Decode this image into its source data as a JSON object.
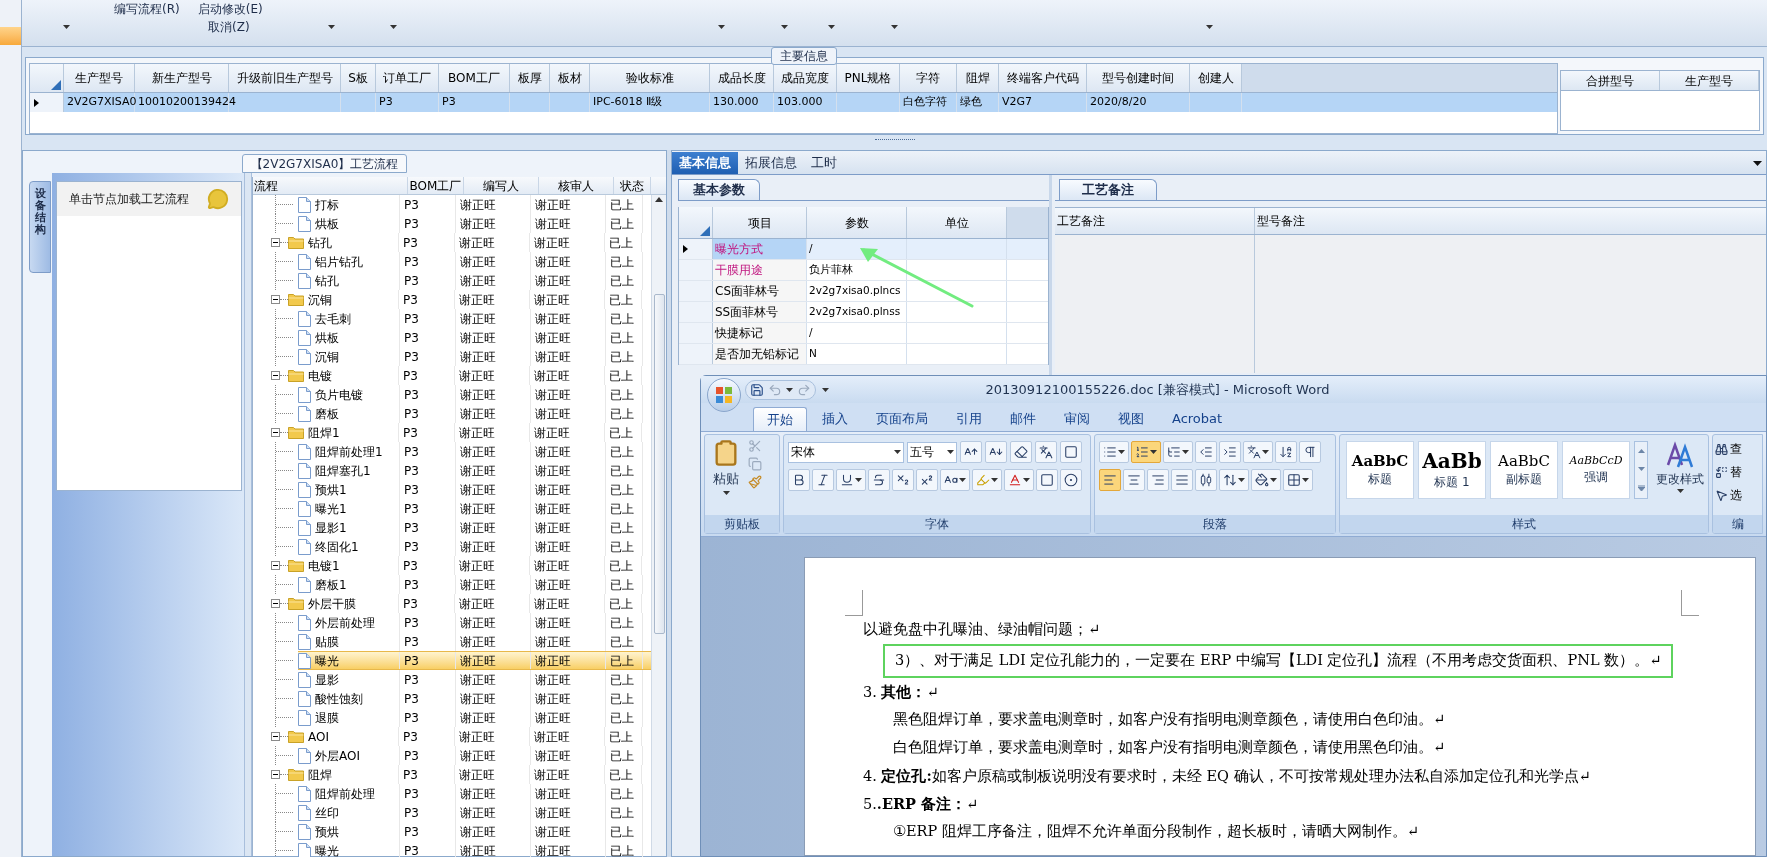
{
  "toolbar": {
    "menu_items": [
      "编写流程(R)",
      "启动修改(E)",
      "取消(Z)"
    ]
  },
  "main_info": {
    "title": "主要信息",
    "columns": [
      "生产型号",
      "新生产型号",
      "升级前旧生产型号",
      "S板",
      "订单工厂",
      "BOM工厂",
      "板厚",
      "板材",
      "验收标准",
      "成品长度",
      "成品宽度",
      "PNL规格",
      "字符",
      "阻焊",
      "终端客户代码",
      "型号创建时间",
      "创建人"
    ],
    "rows": [
      {
        "selected": true,
        "cells": [
          "2V2G7XISA0",
          "10010200139424",
          null,
          null,
          "P3",
          "P3",
          null,
          null,
          "IPC-6018 Ⅱ级",
          "130.000",
          "103.000",
          null,
          "白色字符",
          "绿色",
          "V2G7",
          "2020/8/20",
          null
        ]
      }
    ],
    "side_columns": [
      "合拼型号",
      "生产型号"
    ]
  },
  "process_panel": {
    "title": "【2V2G7XISA0】工艺流程",
    "side_tab": "设备结构",
    "hint": "单击节点加载工艺流程",
    "columns": [
      "流程",
      "BOM工厂",
      "编写人",
      "核审人",
      "状态"
    ],
    "tree": [
      {
        "children": [
          {
            "label": "打标",
            "selected": false,
            "cells": [
              "P3",
              "谢正旺",
              "谢正旺",
              "已上"
            ]
          },
          {
            "label": "烘板",
            "selected": false,
            "cells": [
              "P3",
              "谢正旺",
              "谢正旺",
              "已上"
            ]
          }
        ]
      },
      {
        "label": "钻孔",
        "expanded": true,
        "selected": false,
        "cells": [
          "P3",
          "谢正旺",
          "谢正旺",
          "已上"
        ],
        "children": [
          {
            "label": "铝片钻孔",
            "selected": false,
            "cells": [
              "P3",
              "谢正旺",
              "谢正旺",
              "已上"
            ]
          },
          {
            "label": "钻孔",
            "selected": false,
            "cells": [
              "P3",
              "谢正旺",
              "谢正旺",
              "已上"
            ]
          }
        ]
      },
      {
        "label": "沉铜",
        "expanded": true,
        "selected": false,
        "cells": [
          "P3",
          "谢正旺",
          "谢正旺",
          "已上"
        ],
        "children": [
          {
            "label": "去毛刺",
            "selected": false,
            "cells": [
              "P3",
              "谢正旺",
              "谢正旺",
              "已上"
            ]
          },
          {
            "label": "烘板",
            "selected": false,
            "cells": [
              "P3",
              "谢正旺",
              "谢正旺",
              "已上"
            ]
          },
          {
            "label": "沉铜",
            "selected": false,
            "cells": [
              "P3",
              "谢正旺",
              "谢正旺",
              "已上"
            ]
          }
        ]
      },
      {
        "label": "电镀",
        "expanded": true,
        "selected": false,
        "cells": [
          "P3",
          "谢正旺",
          "谢正旺",
          "已上"
        ],
        "children": [
          {
            "label": "负片电镀",
            "selected": false,
            "cells": [
              "P3",
              "谢正旺",
              "谢正旺",
              "已上"
            ]
          },
          {
            "label": "磨板",
            "selected": false,
            "cells": [
              "P3",
              "谢正旺",
              "谢正旺",
              "已上"
            ]
          }
        ]
      },
      {
        "label": "阻焊1",
        "expanded": true,
        "selected": false,
        "cells": [
          "P3",
          "谢正旺",
          "谢正旺",
          "已上"
        ],
        "children": [
          {
            "label": "阻焊前处理1",
            "selected": false,
            "cells": [
              "P3",
              "谢正旺",
              "谢正旺",
              "已上"
            ]
          },
          {
            "label": "阻焊塞孔1",
            "selected": false,
            "cells": [
              "P3",
              "谢正旺",
              "谢正旺",
              "已上"
            ]
          },
          {
            "label": "预烘1",
            "selected": false,
            "cells": [
              "P3",
              "谢正旺",
              "谢正旺",
              "已上"
            ]
          },
          {
            "label": "曝光1",
            "selected": false,
            "cells": [
              "P3",
              "谢正旺",
              "谢正旺",
              "已上"
            ]
          },
          {
            "label": "显影1",
            "selected": false,
            "cells": [
              "P3",
              "谢正旺",
              "谢正旺",
              "已上"
            ]
          },
          {
            "label": "终固化1",
            "selected": false,
            "cells": [
              "P3",
              "谢正旺",
              "谢正旺",
              "已上"
            ]
          }
        ]
      },
      {
        "label": "电镀1",
        "expanded": true,
        "selected": false,
        "cells": [
          "P3",
          "谢正旺",
          "谢正旺",
          "已上"
        ],
        "children": [
          {
            "label": "磨板1",
            "selected": false,
            "cells": [
              "P3",
              "谢正旺",
              "谢正旺",
              "已上"
            ]
          }
        ]
      },
      {
        "label": "外层干膜",
        "expanded": true,
        "selected": false,
        "cells": [
          "P3",
          "谢正旺",
          "谢正旺",
          "已上"
        ],
        "children": [
          {
            "label": "外层前处理",
            "selected": false,
            "cells": [
              "P3",
              "谢正旺",
              "谢正旺",
              "已上"
            ]
          },
          {
            "label": "贴膜",
            "selected": false,
            "cells": [
              "P3",
              "谢正旺",
              "谢正旺",
              "已上"
            ]
          },
          {
            "label": "曝光",
            "selected": true,
            "cells": [
              "P3",
              "谢正旺",
              "谢正旺",
              "已上"
            ]
          },
          {
            "label": "显影",
            "selected": false,
            "cells": [
              "P3",
              "谢正旺",
              "谢正旺",
              "已上"
            ]
          },
          {
            "label": "酸性蚀刻",
            "selected": false,
            "cells": [
              "P3",
              "谢正旺",
              "谢正旺",
              "已上"
            ]
          },
          {
            "label": "退膜",
            "selected": false,
            "cells": [
              "P3",
              "谢正旺",
              "谢正旺",
              "已上"
            ]
          }
        ]
      },
      {
        "label": "AOI",
        "expanded": true,
        "selected": false,
        "cells": [
          "P3",
          "谢正旺",
          "谢正旺",
          "已上"
        ],
        "children": [
          {
            "label": "外层AOI",
            "selected": false,
            "cells": [
              "P3",
              "谢正旺",
              "谢正旺",
              "已上"
            ]
          }
        ]
      },
      {
        "label": "阻焊",
        "expanded": true,
        "selected": false,
        "cells": [
          "P3",
          "谢正旺",
          "谢正旺",
          "已上"
        ],
        "children": [
          {
            "label": "阻焊前处理",
            "selected": false,
            "cells": [
              "P3",
              "谢正旺",
              "谢正旺",
              "已上"
            ]
          },
          {
            "label": "丝印",
            "selected": false,
            "cells": [
              "P3",
              "谢正旺",
              "谢正旺",
              "已上"
            ]
          },
          {
            "label": "预烘",
            "selected": false,
            "cells": [
              "P3",
              "谢正旺",
              "谢正旺",
              "已上"
            ]
          },
          {
            "label": "曝光",
            "selected": false,
            "cells": [
              "P3",
              "谢正旺",
              "谢正旺",
              "已上"
            ]
          }
        ]
      }
    ]
  },
  "detail_panel": {
    "tabs": [
      {
        "label": "基本信息",
        "selected": true
      },
      {
        "label": "拓展信息",
        "selected": false
      },
      {
        "label": "工时",
        "selected": false
      }
    ],
    "sub_tab": "基本参数",
    "param_columns": [
      "项目",
      "参数",
      "单位"
    ],
    "params": [
      {
        "item": "曝光方式",
        "value": "/",
        "highlight": true,
        "selected": true
      },
      {
        "item": "干膜用途",
        "value": "负片菲林",
        "highlight": true,
        "selected": false
      },
      {
        "item": "CS面菲林号",
        "value": "2v2g7xisa0.plncs",
        "highlight": false,
        "selected": false
      },
      {
        "item": "SS面菲林号",
        "value": "2v2g7xisa0.plnss",
        "highlight": false,
        "selected": false
      },
      {
        "item": "快捷标记",
        "value": "/",
        "highlight": false,
        "selected": false
      },
      {
        "item": "是否加无铅标记",
        "value": "N",
        "highlight": false,
        "selected": false
      }
    ],
    "remarks_tab": "工艺备注",
    "remark_columns": [
      "工艺备注",
      "型号备注"
    ]
  },
  "word_window": {
    "title": "20130912100155226.doc [兼容模式] - Microsoft Word",
    "tabs": [
      {
        "label": "开始",
        "selected": true
      },
      {
        "label": "插入",
        "selected": false
      },
      {
        "label": "页面布局",
        "selected": false
      },
      {
        "label": "引用",
        "selected": false
      },
      {
        "label": "邮件",
        "selected": false
      },
      {
        "label": "审阅",
        "selected": false
      },
      {
        "label": "视图",
        "selected": false
      },
      {
        "label": "Acrobat",
        "selected": false
      }
    ],
    "paste_label": "粘贴",
    "font_name": "宋体",
    "font_size": "五号",
    "paragraph_tools": [
      {
        "kind": "bullets",
        "on": false
      },
      {
        "kind": "numbering",
        "on": true
      },
      {
        "kind": "multilevel",
        "on": false
      },
      {
        "kind": "outdent",
        "on": false
      },
      {
        "kind": "indent",
        "on": false
      },
      {
        "kind": "asian",
        "on": false
      },
      {
        "kind": "sort",
        "on": false
      },
      {
        "kind": "marks",
        "on": false
      }
    ],
    "alignments": [
      {
        "kind": "left",
        "on": true
      },
      {
        "kind": "center",
        "on": false
      },
      {
        "kind": "right",
        "on": false
      },
      {
        "kind": "justify",
        "on": false
      },
      {
        "kind": "distributed",
        "on": false
      }
    ],
    "styles": [
      {
        "kind": "title",
        "preview": "AaBbC",
        "name": "标题"
      },
      {
        "kind": "heading",
        "preview": "AaBb",
        "name": "标题 1"
      },
      {
        "kind": "subtitle",
        "preview": "AaBbC",
        "name": "副标题"
      },
      {
        "kind": "emphasis",
        "preview": "AaBbCcD",
        "name": "强调"
      }
    ],
    "change_styles": "更改样式",
    "edit_items": [
      "查",
      "替",
      "选"
    ],
    "groups": [
      "剪贴板",
      "字体",
      "段落",
      "样式",
      "编"
    ],
    "paragraphs": [
      {
        "text": "以避免盘中孔曝油、绿油帽问题；↵",
        "kind": "plain",
        "framed": false
      },
      {
        "text": "3）、对于满足 LDI 定位孔能力的，一定要在 ERP 中编写【LDI 定位孔】流程（不用考虑交货面积、PNL 数）。↵",
        "kind": "indented",
        "framed": true
      },
      {
        "text": "3. **其他：**↵",
        "kind": "plain",
        "framed": false
      },
      {
        "text": "黑色阻焊订单，要求盖电测章时，如客户没有指明电测章颜色，请使用白色印油。↵",
        "kind": "indented",
        "framed": false
      },
      {
        "text": "白色阻焊订单，要求盖电测章时，如客户没有指明电测章颜色，请使用黑色印油。↵",
        "kind": "indented",
        "framed": false
      },
      {
        "text": "4. **定位孔:**如客户原稿或制板说明没有要求时，未经 EQ 确认，不可按常规处理办法私自添加定位孔和光学点↵",
        "kind": "plain",
        "framed": false
      },
      {
        "text": "5.**.ERP 备注：**↵",
        "kind": "plain",
        "framed": false
      },
      {
        "text": "①ERP 阻焊工序备注，阻焊不允许单面分段制作，超长板时，请晒大网制作。↵",
        "kind": "indented",
        "framed": false
      }
    ]
  }
}
